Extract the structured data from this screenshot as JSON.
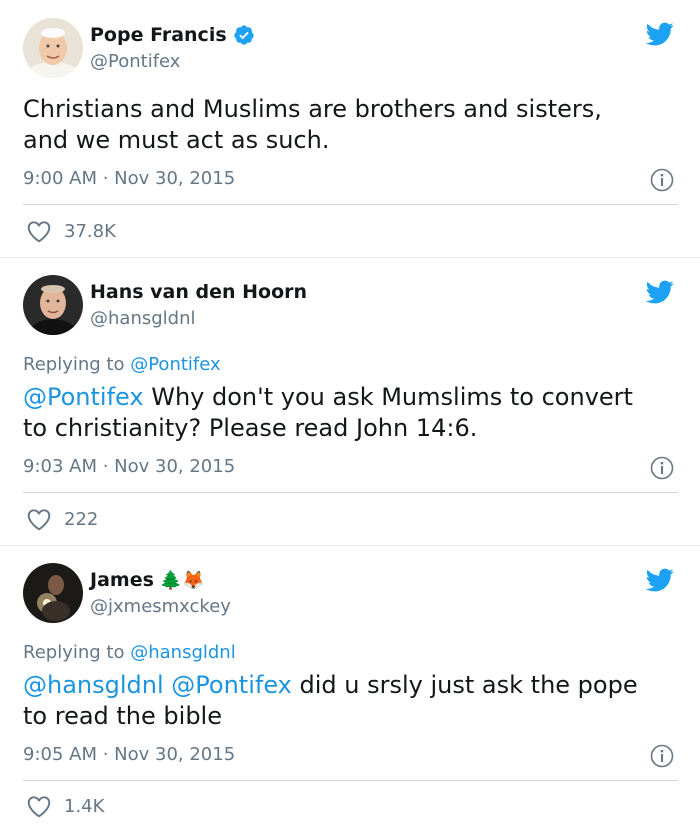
{
  "tweets": [
    {
      "name": "Pope Francis",
      "handle": "@Pontifex",
      "verified": true,
      "replying_prefix": "",
      "replying_to": "",
      "mentions": "",
      "text_line1": "Christians and Muslims are brothers and sisters,",
      "text_line2": "and we must act as such.",
      "timestamp": "9:00 AM · Nov 30, 2015",
      "likes": "37.8K"
    },
    {
      "name": "Hans van den Hoorn",
      "handle": "@hansgldnl",
      "verified": false,
      "replying_prefix": "Replying to",
      "replying_to": "@Pontifex",
      "mentions": "@Pontifex",
      "text_line1_rest": " Why don't you ask Mumslims to convert",
      "text_line2": "to christianity? Please read John 14:6.",
      "timestamp": "9:03 AM · Nov 30, 2015",
      "likes": "222"
    },
    {
      "name": "James",
      "name_emoji": "🌲🦊",
      "handle": "@jxmesmxckey",
      "verified": false,
      "replying_prefix": "Replying to",
      "replying_to": "@hansgldnl",
      "mention1": "@hansgldnl",
      "mention2": "@Pontifex",
      "text_line1_rest": " did u srsly just ask the pope",
      "text_line2": "to read the bible",
      "timestamp": "9:05 AM · Nov 30, 2015",
      "likes": "1.4K"
    }
  ],
  "colors": {
    "link": "#1b95e0",
    "twitter_blue": "#1da1f2",
    "secondary_text": "#657786",
    "primary_text": "#14171a",
    "divider": "#ccd6dd"
  },
  "icons": [
    "twitter-bird-icon",
    "verified-badge-icon",
    "info-icon",
    "heart-icon"
  ]
}
